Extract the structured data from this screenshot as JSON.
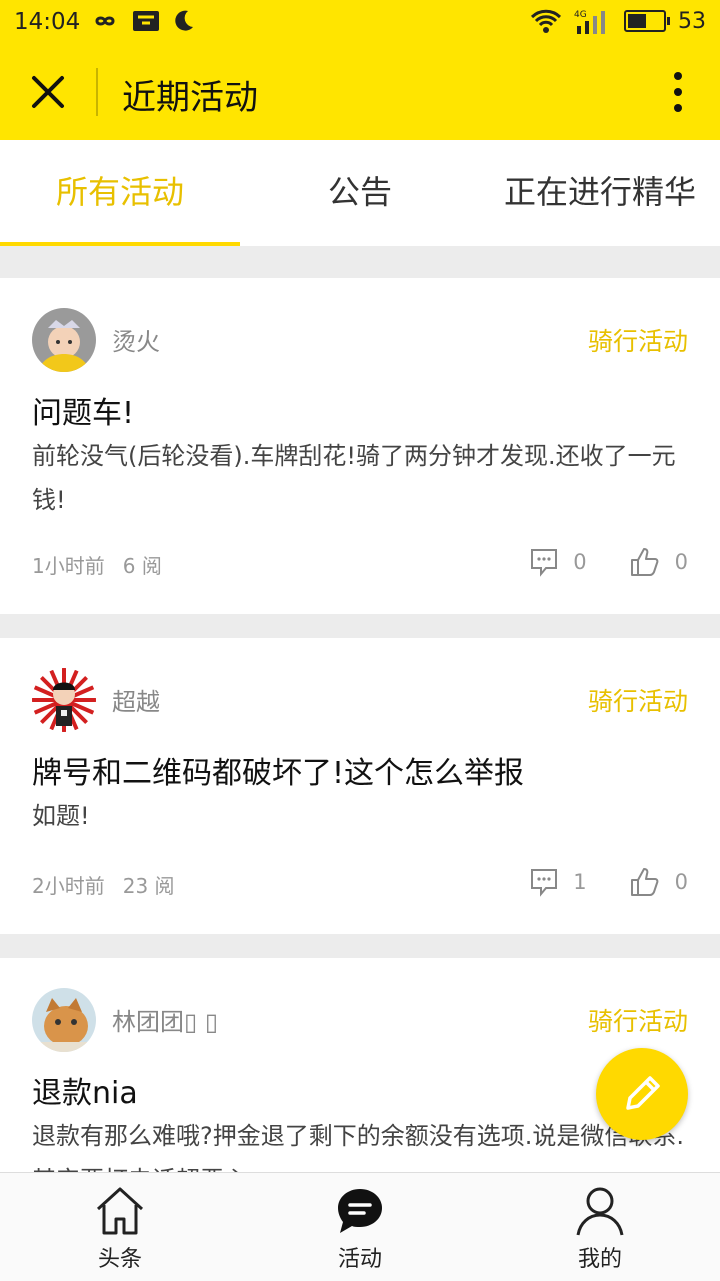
{
  "status_bar": {
    "time": "14:04",
    "battery": "53",
    "battery_fraction": 0.53,
    "network": "4G"
  },
  "header": {
    "title": "近期活动"
  },
  "tabs": [
    {
      "label": "所有活动",
      "active": true
    },
    {
      "label": "公告",
      "active": false
    },
    {
      "label": "正在进行精华",
      "active": false
    }
  ],
  "posts": [
    {
      "author": "烫火",
      "category": "骑行活动",
      "title": "问题车!",
      "excerpt": "前轮没气(后轮没看).车牌刮花!骑了两分钟才发现.还收了一元钱!",
      "time": "1小时前",
      "reads": "6 阅",
      "comments": "0",
      "likes": "0"
    },
    {
      "author": "超越",
      "category": "骑行活动",
      "title": "牌号和二维码都破坏了!这个怎么举报",
      "excerpt": "如题!",
      "time": "2小时前",
      "reads": "23 阅",
      "comments": "1",
      "likes": "0"
    },
    {
      "author": "林团团▯ ▯",
      "category": "骑行活动",
      "title": "退款nia",
      "excerpt": "退款有那么难哦?押金退了剩下的余额没有选项.说是微信联系.其实要打电话超恶心",
      "time": "",
      "reads": "",
      "comments": "",
      "likes": ""
    }
  ],
  "bottom_nav": [
    {
      "label": "头条",
      "icon": "home-icon"
    },
    {
      "label": "活动",
      "icon": "chat-bubble-icon",
      "active": true
    },
    {
      "label": "我的",
      "icon": "user-icon"
    }
  ],
  "colors": {
    "brand": "#ffe500",
    "accent": "#e8c000",
    "fab": "#ffd900"
  }
}
